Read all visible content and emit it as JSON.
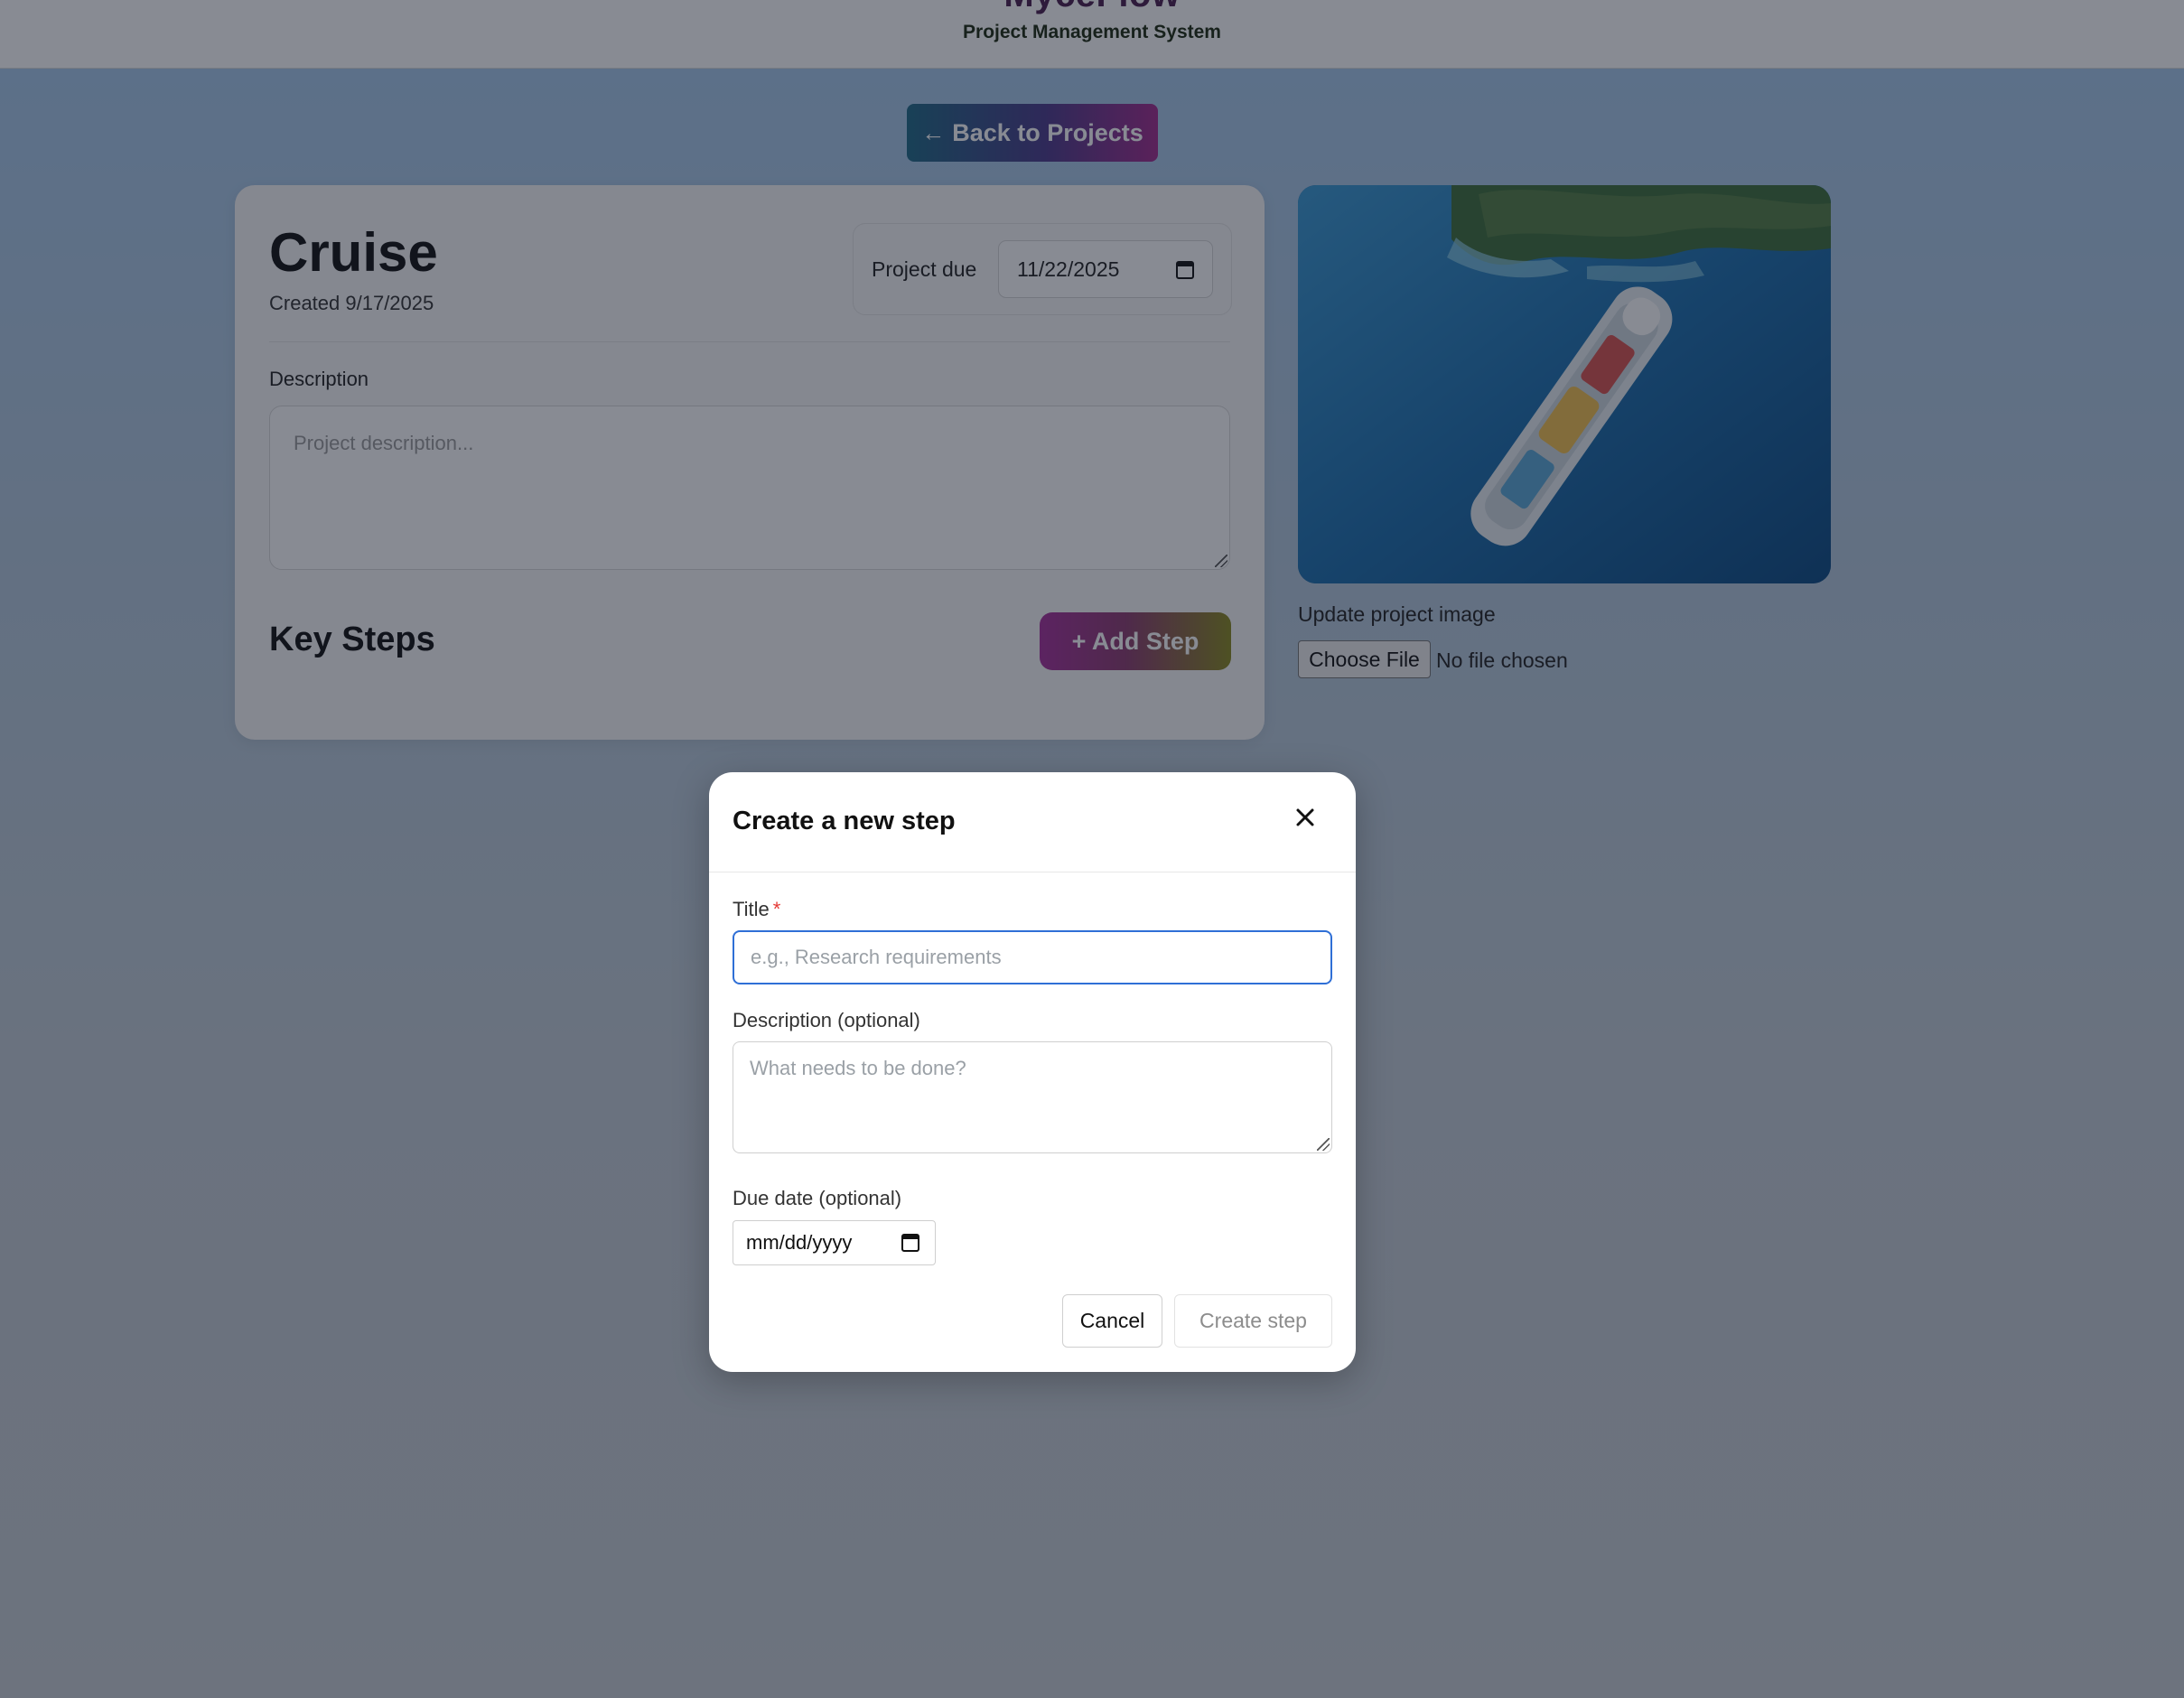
{
  "header": {
    "brand": "MyceFlow",
    "subtitle": "Project Management System"
  },
  "nav": {
    "back_label": "Back to Projects",
    "back_icon": "arrow-left-icon"
  },
  "project": {
    "name": "Cruise",
    "created": "Created 9/17/2025",
    "due_label": "Project due",
    "due_value": "11/22/2025",
    "description_label": "Description",
    "description_placeholder": "Project description...",
    "key_steps_title": "Key Steps",
    "add_step_label": "+ Add Step"
  },
  "image_panel": {
    "image_subject": "cruise ship near island",
    "update_label": "Update project image",
    "choose_file_label": "Choose File",
    "no_file_text": "No file chosen"
  },
  "modal": {
    "title": "Create a new step",
    "close_icon": "close-icon",
    "title_label": "Title",
    "required_mark": "*",
    "title_placeholder": "e.g., Research requirements",
    "description_label": "Description (optional)",
    "description_placeholder": "What needs to be done?",
    "due_label": "Due date (optional)",
    "due_placeholder": "mm/dd/yyyy",
    "cancel_label": "Cancel",
    "create_label": "Create step"
  },
  "colors": {
    "accent_blue": "#2f6fd6",
    "required_red": "#e53935",
    "back_button_gradient": [
      "#1f6a86",
      "#a32b8d"
    ],
    "add_step_gradient": [
      "#a62f9b",
      "#8a8a1f"
    ]
  }
}
